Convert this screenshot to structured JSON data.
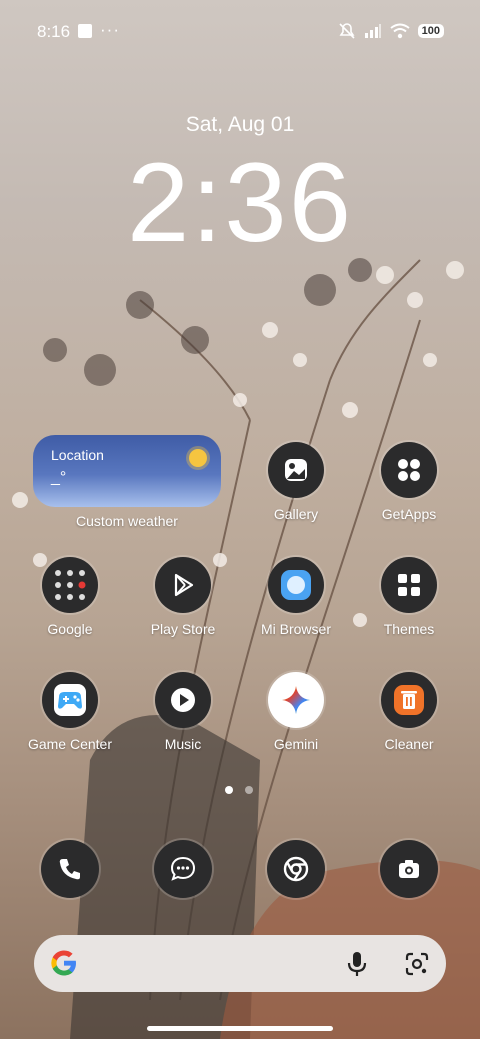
{
  "status_bar": {
    "time": "8:16",
    "dots": "···",
    "battery": "100"
  },
  "lockscreen": {
    "date": "Sat, Aug 01",
    "clock": "2:36"
  },
  "weather_widget": {
    "location": "Location",
    "temp": "_°",
    "label": "Custom weather"
  },
  "apps": [
    {
      "label": "Gallery"
    },
    {
      "label": "GetApps"
    },
    {
      "label": "Google"
    },
    {
      "label": "Play Store"
    },
    {
      "label": "Mi Browser"
    },
    {
      "label": "Themes"
    },
    {
      "label": "Game Center"
    },
    {
      "label": "Music"
    },
    {
      "label": "Gemini"
    },
    {
      "label": "Cleaner"
    }
  ],
  "dock": [
    "phone-icon",
    "messages-icon",
    "chrome-icon",
    "camera-icon"
  ],
  "colors": {
    "dark_icon_bg": "#2b2b2c",
    "cleaner_orange": "#f07329",
    "weather_blue": "#3f5ca6"
  }
}
